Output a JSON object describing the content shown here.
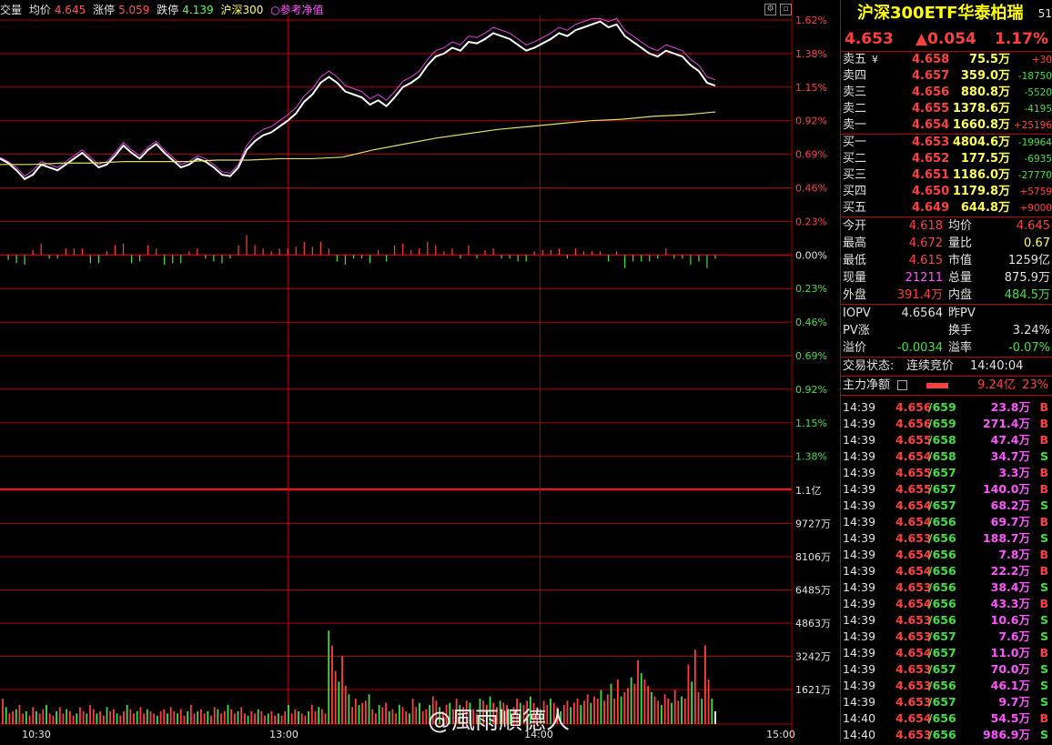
{
  "header": {
    "label_volume": "交量",
    "label_avg": "均价",
    "avg_value": "4.645",
    "label_limit_up": "涨停",
    "limit_up_value": "5.059",
    "label_limit_down": "跌停",
    "limit_down_value": "4.139",
    "label_index": "沪深300",
    "label_ref": "○参考净值"
  },
  "price_axis": [
    "1.62%",
    "1.38%",
    "1.15%",
    "0.92%",
    "0.69%",
    "0.46%",
    "0.23%",
    "0.00%",
    "0.23%",
    "0.46%",
    "0.69%",
    "0.92%",
    "1.15%",
    "1.38%"
  ],
  "volume_axis": [
    "1.1亿",
    "9727万",
    "8106万",
    "6485万",
    "4863万",
    "3242万",
    "1621万"
  ],
  "time_axis": [
    "10:30",
    "13:00",
    "14:00",
    "15:00"
  ],
  "colors": {
    "up": "#ff4040",
    "down": "#40e040",
    "grid": "#b00000",
    "price": "#ffffff",
    "avg": "#e0e060",
    "ref": "#e040e0"
  },
  "panel": {
    "title": "沪深300ETF华泰柏瑞",
    "title_num": "51",
    "price": "4.653",
    "change": "▲0.054",
    "change_pct": "1.17%",
    "sells": [
      {
        "label": "卖五",
        "extra": "¥",
        "price": "4.658",
        "vol": "75.5万",
        "delta": "+30"
      },
      {
        "label": "卖四",
        "extra": "",
        "price": "4.657",
        "vol": "359.0万",
        "delta": "-18750"
      },
      {
        "label": "卖三",
        "extra": "",
        "price": "4.656",
        "vol": "880.8万",
        "delta": "-5520"
      },
      {
        "label": "卖二",
        "extra": "",
        "price": "4.655",
        "vol": "1378.6万",
        "delta": "-4195"
      },
      {
        "label": "卖一",
        "extra": "",
        "price": "4.654",
        "vol": "1660.8万",
        "delta": "+25196"
      }
    ],
    "buys": [
      {
        "label": "买一",
        "price": "4.653",
        "vol": "4804.6万",
        "delta": "-19964"
      },
      {
        "label": "买二",
        "price": "4.652",
        "vol": "177.5万",
        "delta": "-6935"
      },
      {
        "label": "买三",
        "price": "4.651",
        "vol": "1186.0万",
        "delta": "-27770"
      },
      {
        "label": "买四",
        "price": "4.650",
        "vol": "1179.8万",
        "delta": "+5759"
      },
      {
        "label": "买五",
        "price": "4.649",
        "vol": "644.8万",
        "delta": "+9000"
      }
    ],
    "stats": [
      {
        "l1": "今开",
        "v1": "4.618",
        "l2": "均价",
        "v2": "4.645",
        "c1": "#ff4040",
        "c2": "#ff4040"
      },
      {
        "l1": "最高",
        "v1": "4.672",
        "l2": "量比",
        "v2": "0.67",
        "c1": "#ff4040",
        "c2": "#ffff55"
      },
      {
        "l1": "最低",
        "v1": "4.615",
        "l2": "市值",
        "v2": "1259亿",
        "c1": "#ff4040",
        "c2": "#e0e0e0"
      },
      {
        "l1": "现量",
        "v1": "21211",
        "l2": "总量",
        "v2": "875.9万",
        "c1": "#ff55ff",
        "c2": "#e0e0e0"
      },
      {
        "l1": "外盘",
        "v1": "391.4万",
        "l2": "内盘",
        "v2": "484.5万",
        "c1": "#ff4040",
        "c2": "#40e040"
      }
    ],
    "iopv": [
      {
        "l1": "IOPV",
        "v1": "4.6564",
        "l2": "昨PV",
        "v2": "",
        "c1": "#e0e0e0",
        "c2": "#e0e0e0"
      },
      {
        "l1": "PV涨",
        "v1": "",
        "l2": "换手",
        "v2": "3.24%",
        "c1": "#e0e0e0",
        "c2": "#e0e0e0"
      },
      {
        "l1": "溢价",
        "v1": "-0.0034",
        "l2": "溢率",
        "v2": "-0.07%",
        "c1": "#40e040",
        "c2": "#40e040"
      }
    ],
    "trade_status_label": "交易状态:",
    "trade_status": "连续竞价",
    "trade_time": "14:40:04",
    "main_flow_label": "主力净额",
    "main_flow_value": "9.24亿",
    "main_flow_pct": "23%",
    "ticks": [
      {
        "t": "14:39",
        "p": "4.656",
        "n": "/659",
        "v": "23.8万",
        "s": "B"
      },
      {
        "t": "14:39",
        "p": "4.656",
        "n": "/659",
        "v": "271.4万",
        "s": "B"
      },
      {
        "t": "14:39",
        "p": "4.655",
        "n": "/658",
        "v": "47.4万",
        "s": "B"
      },
      {
        "t": "14:39",
        "p": "4.654",
        "n": "/658",
        "v": "34.7万",
        "s": "S"
      },
      {
        "t": "14:39",
        "p": "4.655",
        "n": "/657",
        "v": "3.3万",
        "s": "B"
      },
      {
        "t": "14:39",
        "p": "4.655",
        "n": "/657",
        "v": "140.0万",
        "s": "B"
      },
      {
        "t": "14:39",
        "p": "4.654",
        "n": "/657",
        "v": "68.2万",
        "s": "S"
      },
      {
        "t": "14:39",
        "p": "4.654",
        "n": "/656",
        "v": "69.7万",
        "s": "B"
      },
      {
        "t": "14:39",
        "p": "4.653",
        "n": "/656",
        "v": "188.7万",
        "s": "S"
      },
      {
        "t": "14:39",
        "p": "4.654",
        "n": "/656",
        "v": "7.8万",
        "s": "B"
      },
      {
        "t": "14:39",
        "p": "4.654",
        "n": "/656",
        "v": "22.2万",
        "s": "B"
      },
      {
        "t": "14:39",
        "p": "4.653",
        "n": "/656",
        "v": "38.4万",
        "s": "S"
      },
      {
        "t": "14:39",
        "p": "4.654",
        "n": "/656",
        "v": "43.3万",
        "s": "B"
      },
      {
        "t": "14:39",
        "p": "4.653",
        "n": "/656",
        "v": "10.6万",
        "s": "S"
      },
      {
        "t": "14:39",
        "p": "4.653",
        "n": "/657",
        "v": "7.6万",
        "s": "S"
      },
      {
        "t": "14:39",
        "p": "4.654",
        "n": "/657",
        "v": "11.0万",
        "s": "B"
      },
      {
        "t": "14:39",
        "p": "4.653",
        "n": "/657",
        "v": "70.0万",
        "s": "S"
      },
      {
        "t": "14:39",
        "p": "4.653",
        "n": "/656",
        "v": "46.1万",
        "s": "S"
      },
      {
        "t": "14:39",
        "p": "4.653",
        "n": "/657",
        "v": "9.7万",
        "s": "S"
      },
      {
        "t": "14:40",
        "p": "4.654",
        "n": "/656",
        "v": "54.5万",
        "s": "B"
      },
      {
        "t": "14:40",
        "p": "4.653",
        "n": "/656",
        "v": "986.9万",
        "s": "S"
      }
    ]
  },
  "watermark": "@風雨順德人",
  "chart_data": {
    "type": "line",
    "title": "",
    "x_range": [
      "09:30",
      "15:00"
    ],
    "y_range_pct": [
      -0.46,
      1.62
    ],
    "series": [
      {
        "name": "price",
        "values": [
          0.66,
          0.63,
          0.58,
          0.52,
          0.55,
          0.62,
          0.6,
          0.58,
          0.62,
          0.66,
          0.7,
          0.65,
          0.6,
          0.62,
          0.68,
          0.75,
          0.7,
          0.66,
          0.72,
          0.76,
          0.7,
          0.65,
          0.6,
          0.62,
          0.66,
          0.64,
          0.6,
          0.55,
          0.54,
          0.6,
          0.72,
          0.78,
          0.82,
          0.84,
          0.88,
          0.92,
          0.97,
          1.05,
          1.1,
          1.18,
          1.22,
          1.18,
          1.12,
          1.1,
          1.08,
          1.03,
          1.06,
          1.02,
          1.08,
          1.15,
          1.18,
          1.22,
          1.3,
          1.36,
          1.38,
          1.42,
          1.4,
          1.46,
          1.45,
          1.48,
          1.52,
          1.5,
          1.48,
          1.44,
          1.4,
          1.42,
          1.45,
          1.48,
          1.52,
          1.5,
          1.54,
          1.56,
          1.58,
          1.6,
          1.56,
          1.58,
          1.5,
          1.46,
          1.42,
          1.38,
          1.36,
          1.4,
          1.38,
          1.36,
          1.3,
          1.26,
          1.18,
          1.16
        ]
      },
      {
        "name": "avg",
        "values": [
          0.62,
          0.62,
          0.63,
          0.63,
          0.64,
          0.64,
          0.64,
          0.65,
          0.65,
          0.66,
          0.66,
          0.67,
          0.72,
          0.76,
          0.8,
          0.83,
          0.86,
          0.88,
          0.9,
          0.92,
          0.93,
          0.95,
          0.96,
          0.98
        ]
      },
      {
        "name": "ref",
        "values": [
          0.67,
          0.64,
          0.6,
          0.54,
          0.58,
          0.64,
          0.62,
          0.6,
          0.64,
          0.68,
          0.72,
          0.67,
          0.62,
          0.64,
          0.7,
          0.77,
          0.72,
          0.68,
          0.74,
          0.78,
          0.72,
          0.67,
          0.62,
          0.64,
          0.68,
          0.66,
          0.62,
          0.57,
          0.56,
          0.62,
          0.75,
          0.82,
          0.86,
          0.88,
          0.92,
          0.96,
          1.01,
          1.09,
          1.14,
          1.22,
          1.26,
          1.22,
          1.16,
          1.14,
          1.12,
          1.07,
          1.1,
          1.06,
          1.12,
          1.19,
          1.22,
          1.26,
          1.34,
          1.4,
          1.42,
          1.46,
          1.44,
          1.5,
          1.49,
          1.52,
          1.56,
          1.54,
          1.52,
          1.48,
          1.44,
          1.46,
          1.49,
          1.52,
          1.56,
          1.54,
          1.58,
          1.6,
          1.62,
          1.62,
          1.6,
          1.62,
          1.54,
          1.5,
          1.46,
          1.42,
          1.4,
          1.44,
          1.42,
          1.4,
          1.34,
          1.3,
          1.22,
          1.2
        ]
      }
    ],
    "volume_yi": [
      0.12,
      0.08,
      0.05,
      0.06,
      0.07,
      0.09,
      0.05,
      0.06,
      0.04,
      0.08,
      0.06,
      0.05,
      0.07,
      0.09,
      0.05,
      0.04,
      0.06,
      0.08,
      0.05,
      0.07,
      0.06,
      0.04,
      0.05,
      0.08,
      0.06,
      0.05,
      0.09,
      0.07,
      0.05,
      0.06,
      0.04,
      0.08,
      0.06,
      0.07,
      0.05,
      0.04,
      0.06,
      0.09,
      0.07,
      0.05,
      0.06,
      0.08,
      0.05,
      0.07,
      0.06,
      0.05,
      0.04,
      0.06,
      0.07,
      0.05,
      0.08,
      0.06,
      0.05,
      0.07,
      0.04,
      0.06,
      0.09,
      0.05,
      0.06,
      0.07,
      0.05,
      0.06,
      0.04,
      0.08,
      0.07,
      0.05,
      0.06,
      0.09,
      0.07,
      0.05,
      0.06,
      0.08,
      0.05,
      0.04,
      0.06,
      0.05,
      0.07,
      0.06,
      0.04,
      0.05,
      0.06,
      0.04,
      0.05,
      0.04,
      0.06,
      0.09,
      0.05,
      0.07,
      0.06,
      0.05,
      0.04,
      0.06,
      0.09,
      0.06,
      0.08,
      0.07,
      0.05,
      0.44,
      0.37,
      0.25,
      0.2,
      0.32,
      0.18,
      0.14,
      0.08,
      0.12,
      0.09,
      0.1,
      0.11,
      0.14,
      0.07,
      0.05,
      0.09,
      0.08,
      0.1,
      0.06,
      0.07,
      0.05,
      0.09,
      0.08,
      0.06,
      0.05,
      0.12,
      0.08,
      0.1,
      0.06,
      0.07,
      0.09,
      0.13,
      0.11,
      0.08,
      0.06,
      0.09,
      0.1,
      0.07,
      0.12,
      0.09,
      0.08,
      0.11,
      0.1,
      0.07,
      0.05,
      0.12,
      0.11,
      0.09,
      0.13,
      0.1,
      0.08,
      0.11,
      0.1,
      0.09,
      0.07,
      0.08,
      0.12,
      0.1,
      0.09,
      0.11,
      0.13,
      0.1,
      0.08,
      0.07,
      0.11,
      0.09,
      0.12,
      0.1,
      0.08,
      0.06,
      0.09,
      0.11,
      0.08,
      0.1,
      0.12,
      0.09,
      0.11,
      0.14,
      0.1,
      0.13,
      0.12,
      0.16,
      0.11,
      0.14,
      0.19,
      0.12,
      0.21,
      0.13,
      0.15,
      0.17,
      0.22,
      0.19,
      0.3,
      0.24,
      0.21,
      0.18,
      0.15,
      0.13,
      0.11,
      0.09,
      0.14,
      0.12,
      0.1,
      0.16,
      0.11,
      0.13,
      0.12,
      0.28,
      0.2,
      0.35,
      0.15,
      0.12,
      0.37,
      0.21,
      0.12,
      0.06
    ]
  }
}
